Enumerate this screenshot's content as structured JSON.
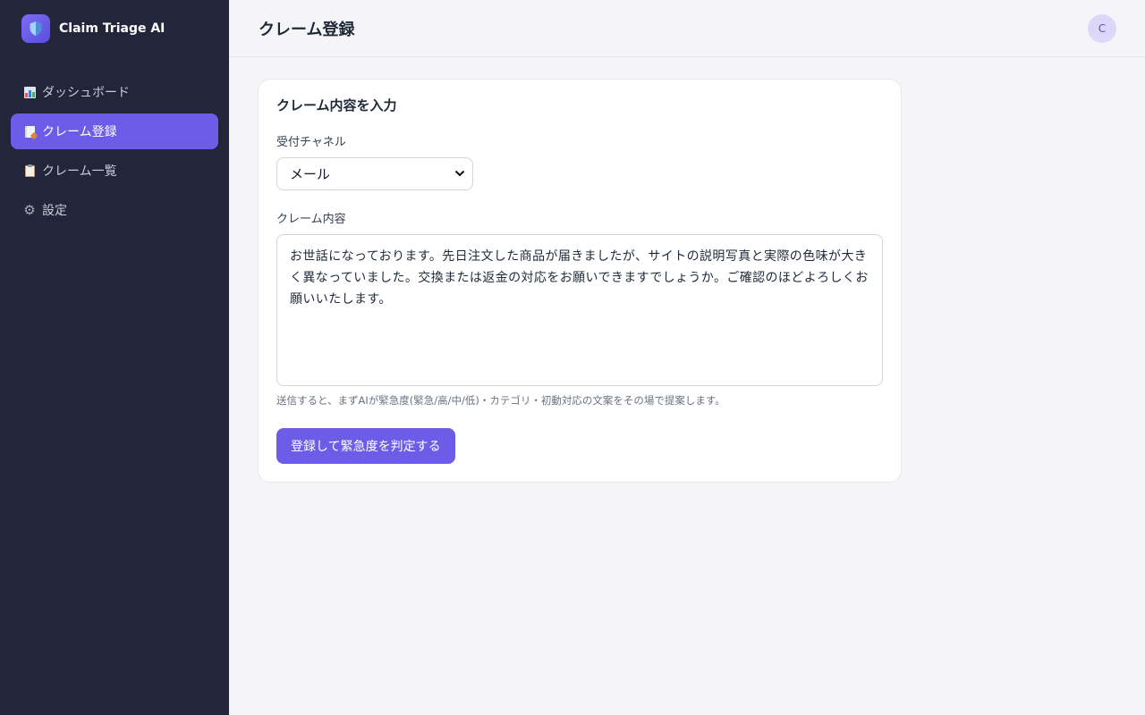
{
  "brand": {
    "name": "Claim Triage AI",
    "icon": "shield-icon",
    "accent": "#6c5ce7"
  },
  "sidebar": {
    "items": [
      {
        "label": "ダッシュボード",
        "icon": "chart-icon",
        "active": false
      },
      {
        "label": "クレーム登録",
        "icon": "document-icon",
        "active": true
      },
      {
        "label": "クレーム一覧",
        "icon": "clipboard-icon",
        "active": false
      },
      {
        "label": "設定",
        "icon": "gear-icon",
        "active": false
      }
    ]
  },
  "header": {
    "title": "クレーム登録",
    "avatar_initial": "C"
  },
  "form": {
    "card_title": "クレーム内容を入力",
    "channel_label": "受付チャネル",
    "channel_value": "メール",
    "content_label": "クレーム内容",
    "content_value": "お世話になっております。先日注文した商品が届きましたが、サイトの説明写真と実際の色味が大きく異なっていました。交換または返金の対応をお願いできますでしょうか。ご確認のほどよろしくお願いいたします。",
    "hint": "送信すると、まずAIが緊急度(緊急/高/中/低)・カテゴリ・初動対応の文案をその場で提案します。",
    "submit_label": "登録して緊急度を判定する"
  }
}
